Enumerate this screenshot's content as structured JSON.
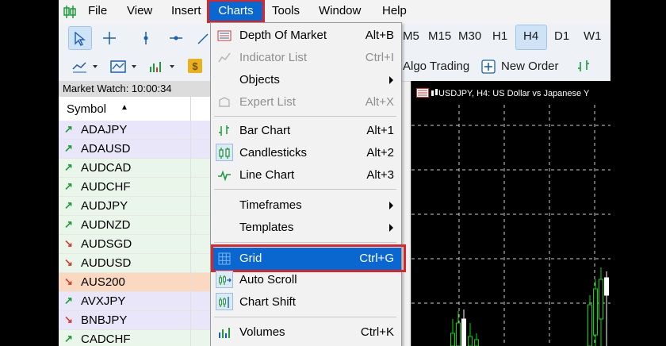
{
  "menubar": {
    "items": [
      "File",
      "View",
      "Insert",
      "Charts",
      "Tools",
      "Window",
      "Help"
    ]
  },
  "timeframes": [
    "M5",
    "M15",
    "M30",
    "H1",
    "H4",
    "D1",
    "W1"
  ],
  "toolbar": {
    "algo_trading": "Algo Trading",
    "new_order": "New Order"
  },
  "market_watch": {
    "title": "Market Watch: 10:00:34",
    "column_symbol": "Symbol",
    "rows": [
      {
        "symbol": "ADAJPY",
        "dir": "up",
        "bg": "#e8e6f8"
      },
      {
        "symbol": "ADAUSD",
        "dir": "up",
        "bg": "#e8e6f8"
      },
      {
        "symbol": "AUDCAD",
        "dir": "up",
        "bg": "#eaf6ea"
      },
      {
        "symbol": "AUDCHF",
        "dir": "up",
        "bg": "#eaf6ea"
      },
      {
        "symbol": "AUDJPY",
        "dir": "up",
        "bg": "#eaf6ea"
      },
      {
        "symbol": "AUDNZD",
        "dir": "up",
        "bg": "#eaf6ea"
      },
      {
        "symbol": "AUDSGD",
        "dir": "down",
        "bg": "#eaf6ea"
      },
      {
        "symbol": "AUDUSD",
        "dir": "down",
        "bg": "#eaf6ea"
      },
      {
        "symbol": "AUS200",
        "dir": "down",
        "bg": "#fbd9c0"
      },
      {
        "symbol": "AVXJPY",
        "dir": "up",
        "bg": "#e8e6f8"
      },
      {
        "symbol": "BNBJPY",
        "dir": "down",
        "bg": "#e8e6f8"
      },
      {
        "symbol": "CADCHF",
        "dir": "up",
        "bg": "#eaf6ea"
      }
    ]
  },
  "chart": {
    "title": "USDJPY, H4:  US Dollar vs Japanese Y"
  },
  "charts_menu": {
    "items": [
      {
        "label": "Depth Of Market",
        "shortcut": "Alt+B",
        "icon": "depth-of-market-icon",
        "state": "normal"
      },
      {
        "label": "Indicator List",
        "shortcut": "Ctrl+I",
        "icon": "indicator-list-icon",
        "state": "disabled"
      },
      {
        "label": "Objects",
        "shortcut": "",
        "icon": "",
        "state": "submenu"
      },
      {
        "label": "Expert List",
        "shortcut": "Alt+X",
        "icon": "expert-list-icon",
        "state": "disabled"
      },
      {
        "label": "Bar Chart",
        "shortcut": "Alt+1",
        "icon": "bar-chart-icon",
        "state": "normal"
      },
      {
        "label": "Candlesticks",
        "shortcut": "Alt+2",
        "icon": "candlesticks-icon",
        "state": "checked"
      },
      {
        "label": "Line Chart",
        "shortcut": "Alt+3",
        "icon": "line-chart-icon",
        "state": "normal"
      },
      {
        "label": "Timeframes",
        "shortcut": "",
        "icon": "",
        "state": "submenu"
      },
      {
        "label": "Templates",
        "shortcut": "",
        "icon": "",
        "state": "submenu"
      },
      {
        "label": "Grid",
        "shortcut": "Ctrl+G",
        "icon": "grid-icon",
        "state": "highlighted"
      },
      {
        "label": "Auto Scroll",
        "shortcut": "",
        "icon": "auto-scroll-icon",
        "state": "checked"
      },
      {
        "label": "Chart Shift",
        "shortcut": "",
        "icon": "chart-shift-icon",
        "state": "checked"
      },
      {
        "label": "Volumes",
        "shortcut": "Ctrl+K",
        "icon": "volumes-icon",
        "state": "normal"
      }
    ]
  },
  "colors": {
    "accent": "#0b67d0",
    "highlight_box": "#d9262b",
    "up_arrow": "#1a9c3a",
    "down_arrow": "#d23b2b",
    "candle_up": "#00e000",
    "candle_down": "#ffffff",
    "grid": "#ffffff"
  }
}
